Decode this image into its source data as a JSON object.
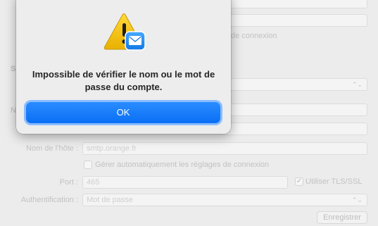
{
  "dialog": {
    "message": "Impossible de vérifier le nom ou le mot de passe du compte.",
    "ok_label": "OK",
    "icon": "warning-triangle-with-mail-icon"
  },
  "form": {
    "partial_text_connexion": "de connexion",
    "partial_label_s": "S",
    "partial_label_n": "N",
    "hostname_label": "Nom de l’hôte :",
    "hostname_value": "smtp.orange.fr",
    "auto_manage_label": "Gérer automatiquement les réglages de connexion",
    "auto_manage_checked": false,
    "port_label": "Port :",
    "port_value": "465",
    "tls_label": "Utiliser TLS/SSL",
    "tls_checked": true,
    "auth_label": "Authentification :",
    "auth_value": "Mot de passe",
    "save_label": "Enregistrer"
  },
  "colors": {
    "accent": "#0a6ff5",
    "focus_ring": "#8bbcff",
    "warning_yellow": "#f5c400",
    "mail_badge": "#1e8cf0"
  }
}
